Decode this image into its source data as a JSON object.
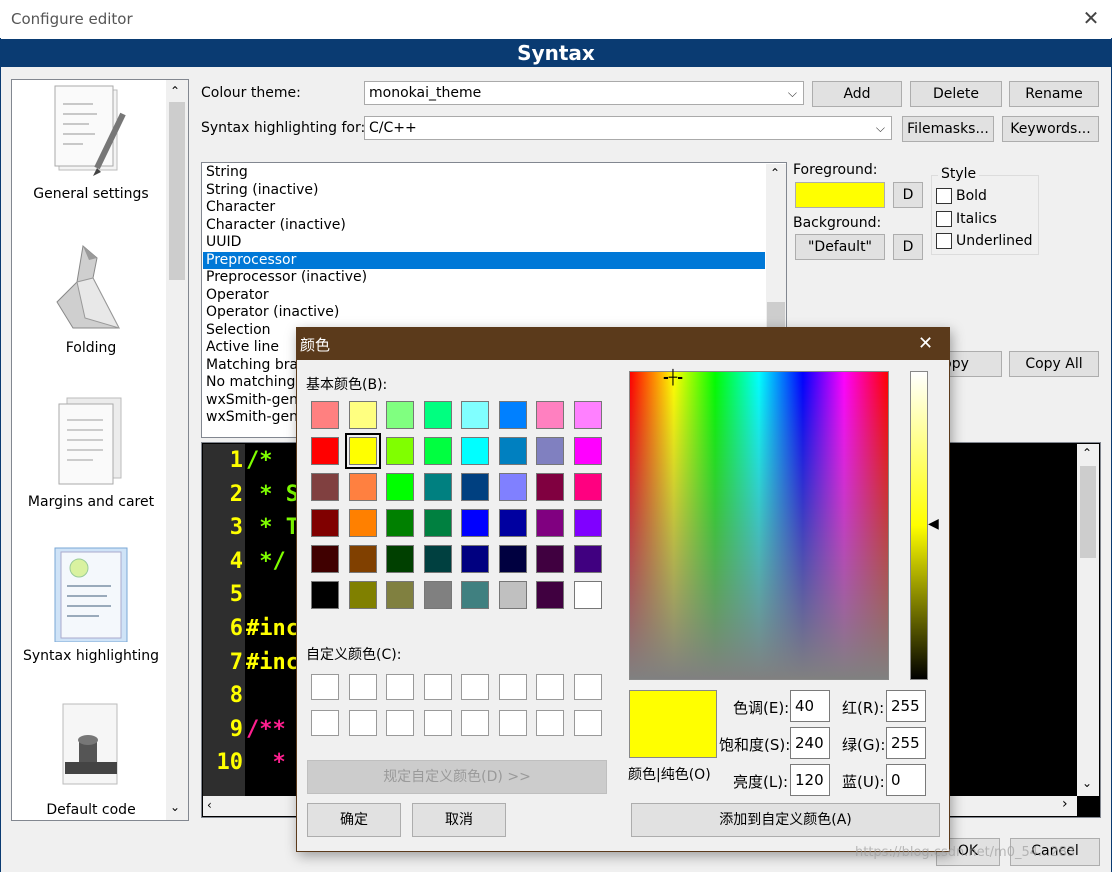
{
  "window": {
    "title": "Configure editor",
    "header": "Syntax"
  },
  "sidebar": {
    "items": [
      {
        "label": "General settings",
        "icon": "document-pencil-icon"
      },
      {
        "label": "Folding",
        "icon": "origami-bird-icon"
      },
      {
        "label": "Margins and caret",
        "icon": "document-pages-icon"
      },
      {
        "label": "Syntax highlighting",
        "icon": "highlighted-document-icon"
      },
      {
        "label": "Default code",
        "icon": "stamp-icon"
      }
    ]
  },
  "form": {
    "colour_theme_label": "Colour theme:",
    "colour_theme_value": "monokai_theme",
    "add_label": "Add",
    "delete_label": "Delete",
    "rename_label": "Rename",
    "syntax_for_label": "Syntax highlighting for:",
    "syntax_for_value": "C/C++",
    "filemasks_label": "Filemasks...",
    "keywords_label": "Keywords...",
    "foreground_label": "Foreground:",
    "background_label": "Background:",
    "background_value": "\"Default\"",
    "d_label": "D",
    "style_label": "Style",
    "bold_label": "Bold",
    "italics_label": "Italics",
    "underlined_label": "Underlined",
    "copy_label": "opy",
    "copy_all_label": "Copy All",
    "ok_label": "OK",
    "cancel_label": "Cancel",
    "foreground_color": "#ffff00"
  },
  "styles_list": [
    "String",
    "String (inactive)",
    "Character",
    "Character (inactive)",
    "UUID",
    "Preprocessor",
    "Preprocessor (inactive)",
    "Operator",
    "Operator (inactive)",
    "Selection",
    "Active line",
    "Matching bra",
    "No matching",
    "wxSmith-gen",
    "wxSmith-gen"
  ],
  "selected_style": "Preprocessor",
  "preview": {
    "line_numbers": [
      "1",
      "2",
      "3",
      "4",
      "5",
      "6",
      "7",
      "8",
      "9",
      "10"
    ],
    "code_lines": [
      "/*",
      " * Sc",
      " * Th",
      " */",
      "",
      "#inc",
      "#inc",
      "",
      "/**",
      "  * T"
    ]
  },
  "color_dialog": {
    "title": "颜色",
    "basic_colors_label": "基本颜色(B):",
    "custom_colors_label": "自定义颜色(C):",
    "define_custom_label": "规定自定义颜色(D) >>",
    "ok_label": "确定",
    "cancel_label": "取消",
    "solid_label": "颜色|纯色(O)",
    "hue_label": "色调(E):",
    "sat_label": "饱和度(S):",
    "lum_label": "亮度(L):",
    "red_label": "红(R):",
    "green_label": "绿(G):",
    "blue_label": "蓝(U):",
    "hue": "40",
    "sat": "240",
    "lum": "120",
    "red": "255",
    "green": "255",
    "blue": "0",
    "add_custom_label": "添加到自定义颜色(A)",
    "selected_color": "#ffff00",
    "basic_colors": [
      "#ff8080",
      "#ffff80",
      "#80ff80",
      "#00ff80",
      "#80ffff",
      "#0080ff",
      "#ff80c0",
      "#ff80ff",
      "#ff0000",
      "#ffff00",
      "#80ff00",
      "#00ff40",
      "#00ffff",
      "#0080c0",
      "#8080c0",
      "#ff00ff",
      "#804040",
      "#ff8040",
      "#00ff00",
      "#008080",
      "#004080",
      "#8080ff",
      "#800040",
      "#ff0080",
      "#800000",
      "#ff8000",
      "#008000",
      "#008040",
      "#0000ff",
      "#0000a0",
      "#800080",
      "#8000ff",
      "#400000",
      "#804000",
      "#004000",
      "#004040",
      "#000080",
      "#000040",
      "#400040",
      "#400080",
      "#000000",
      "#808000",
      "#808040",
      "#808080",
      "#408080",
      "#c0c0c0",
      "#400040",
      "#ffffff"
    ]
  },
  "watermark": "https://blog.csdn.net/m0_54...283"
}
